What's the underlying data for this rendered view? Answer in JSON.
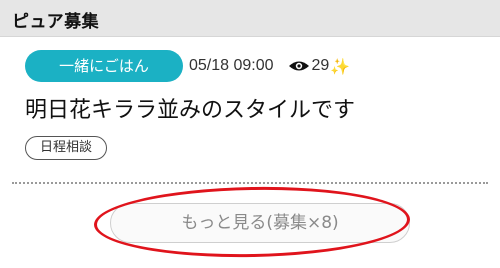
{
  "section": {
    "title": "ピュア募集"
  },
  "post": {
    "category": "一緒にごはん",
    "date": "05/18 09:00",
    "views": "29",
    "title": "明日花キララ並みのスタイルです",
    "schedule_tag": "日程相談"
  },
  "more_button": {
    "label": "もっと見る(募集×8)"
  },
  "icons": {
    "views": "eye-icon",
    "sparkle": "sparkle-icon"
  },
  "colors": {
    "accent": "#1bb1c4",
    "annotation": "#e0141c"
  }
}
